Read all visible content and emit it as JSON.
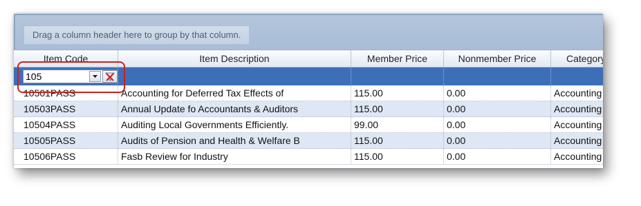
{
  "group_panel": {
    "hint": "Drag a column header here to group by that column."
  },
  "columns": [
    {
      "label": "Item Code"
    },
    {
      "label": "Item Description"
    },
    {
      "label": "Member Price"
    },
    {
      "label": "Nonmember Price"
    },
    {
      "label": "Category"
    }
  ],
  "filter": {
    "item_code_value": "105",
    "dropdown_icon": "chevron-down-icon",
    "clear_icon": "clear-filter-icon"
  },
  "rows": [
    {
      "item_code": "10501PASS",
      "description": "Accounting for Deferred Tax Effects of",
      "member_price": "115.00",
      "nonmember_price": "0.00",
      "category": "Accounting"
    },
    {
      "item_code": "10503PASS",
      "description": "Annual Update fo Accountants & Auditors",
      "member_price": "115.00",
      "nonmember_price": "0.00",
      "category": "Accounting"
    },
    {
      "item_code": "10504PASS",
      "description": "Auditing Local Governments Efficiently.",
      "member_price": "99.00",
      "nonmember_price": "0.00",
      "category": "Accounting"
    },
    {
      "item_code": "10505PASS",
      "description": "Audits of Pension and Health & Welfare B",
      "member_price": "115.00",
      "nonmember_price": "0.00",
      "category": "Accounting"
    },
    {
      "item_code": "10506PASS",
      "description": "Fasb Review for Industry",
      "member_price": "115.00",
      "nonmember_price": "0.00",
      "category": "Accounting"
    }
  ],
  "colors": {
    "filter_row": "#3d6fb8",
    "alt_row": "#dfe7f4",
    "callout": "#cc1f1f"
  }
}
